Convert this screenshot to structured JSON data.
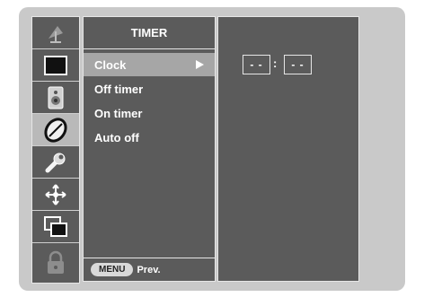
{
  "menu": {
    "title": "TIMER",
    "items": [
      {
        "label": "Clock",
        "selected": true
      },
      {
        "label": "Off timer",
        "selected": false
      },
      {
        "label": "On timer",
        "selected": false
      },
      {
        "label": "Auto off",
        "selected": false
      }
    ],
    "footer": {
      "key": "MENU",
      "action": "Prev."
    }
  },
  "clock": {
    "hours": "- -",
    "separator": ":",
    "minutes": "- -"
  },
  "icons": [
    {
      "name": "antenna-icon",
      "active": false
    },
    {
      "name": "picture-icon",
      "active": false
    },
    {
      "name": "speaker-icon",
      "active": false
    },
    {
      "name": "timer-icon",
      "active": true
    },
    {
      "name": "wrench-icon",
      "active": false
    },
    {
      "name": "special-settings-icon",
      "active": false
    },
    {
      "name": "screen-icon",
      "active": false
    },
    {
      "name": "lock-icon",
      "active": false
    }
  ],
  "colors": {
    "panel": "#5b5b5b",
    "frame": "#c9c9c9",
    "highlight": "#a6a6a6",
    "text": "#ffffff"
  }
}
